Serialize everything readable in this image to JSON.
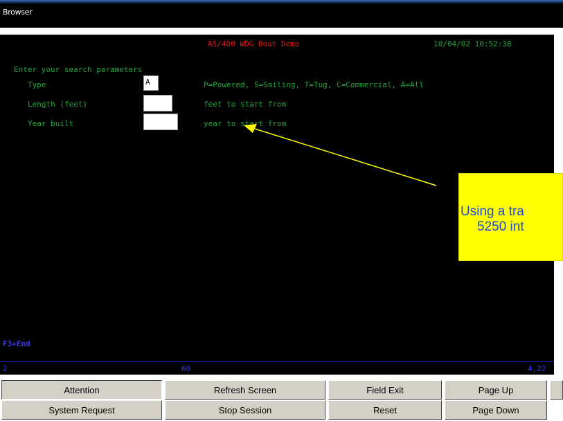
{
  "window": {
    "title": "Browser"
  },
  "terminal": {
    "header_title": "AS/400 WDG Boat Demo",
    "header_datetime": "10/04/02 10:52:38",
    "prompt": "Enter your search parameters",
    "fields": [
      {
        "label": "Type",
        "value": "A",
        "hint": "P=Powered, S=Sailing, T=Tug, C=Commercial, A=All"
      },
      {
        "label": "Length (feet)",
        "value": "",
        "hint": "feet to start from"
      },
      {
        "label": "Year built",
        "value": "",
        "hint": "year to start from"
      }
    ],
    "function_keys": "F3=End",
    "status_left": "2",
    "status_mid": "60",
    "status_right": "4,22"
  },
  "callout": {
    "line1": "Using a tra",
    "line2": "5250 int"
  },
  "buttons": {
    "row1": [
      "Attention",
      "Refresh Screen",
      "Field Exit",
      "Page Up"
    ],
    "row2": [
      "System Request",
      "Stop Session",
      "Reset",
      "Page Down"
    ]
  },
  "colors": {
    "terminal_bg": "#000000",
    "green_text": "#1fa83a",
    "red_text": "#e0161a",
    "blue_text": "#3a3ae8",
    "callout_bg": "#ffff00",
    "callout_text": "#1e4ec8",
    "button_face": "#d4d0c8",
    "arrow": "#ffff00"
  }
}
